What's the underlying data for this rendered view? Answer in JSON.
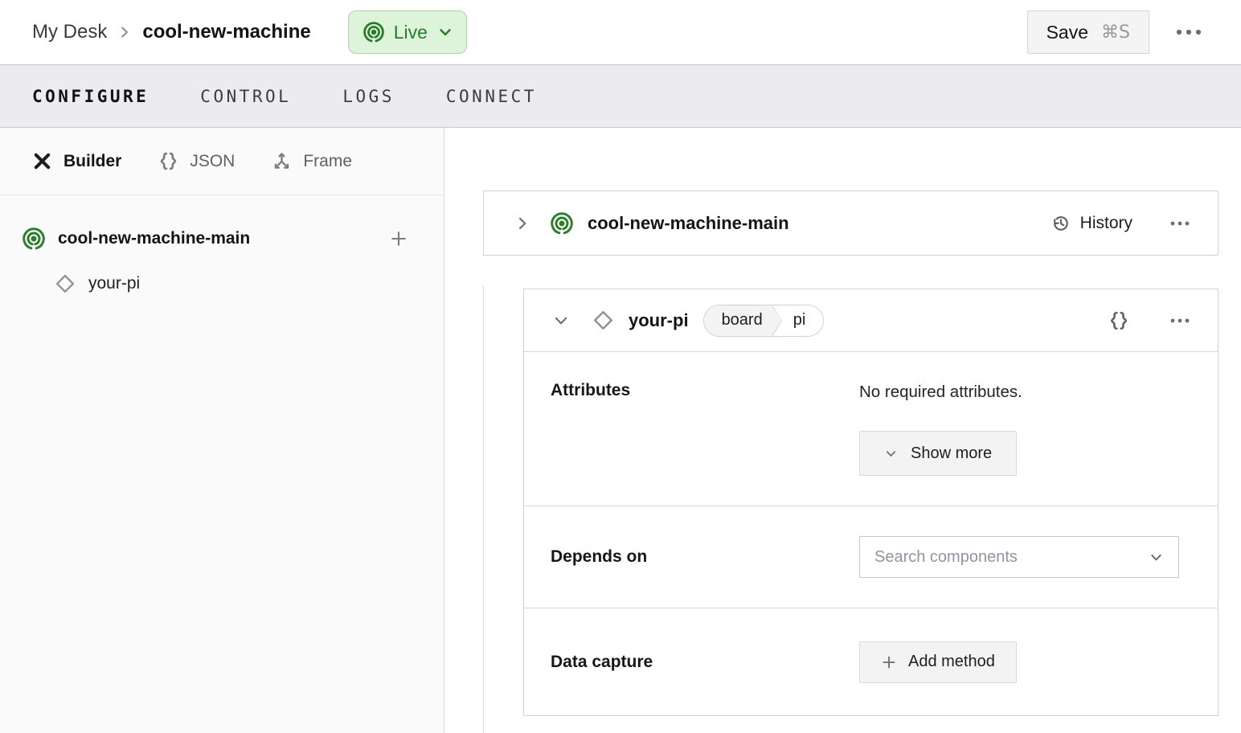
{
  "topbar": {
    "breadcrumb": {
      "parent": "My Desk",
      "current": "cool-new-machine"
    },
    "live_badge": {
      "label": "Live",
      "icon": "broadcast-icon"
    },
    "save_button": {
      "label": "Save",
      "shortcut": "⌘S"
    },
    "overflow_icon": "ellipsis-icon"
  },
  "tabs": [
    {
      "label": "CONFIGURE",
      "active": true
    },
    {
      "label": "CONTROL",
      "active": false
    },
    {
      "label": "LOGS",
      "active": false
    },
    {
      "label": "CONNECT",
      "active": false
    }
  ],
  "sidebar": {
    "modes": [
      {
        "label": "Builder",
        "icon": "crossed-tools-icon",
        "active": true
      },
      {
        "label": "JSON",
        "icon": "braces-icon",
        "active": false
      },
      {
        "label": "Frame",
        "icon": "frame-axes-icon",
        "active": false
      }
    ],
    "tree": {
      "machine": {
        "label": "cool-new-machine-main",
        "icon": "broadcast-icon",
        "add_icon": "plus-icon"
      },
      "component": {
        "label": "your-pi",
        "icon": "diamond-icon"
      }
    }
  },
  "main": {
    "machine_card": {
      "title": "cool-new-machine-main",
      "history_label": "History",
      "icon": "broadcast-icon"
    },
    "component_card": {
      "title": "your-pi",
      "type_tag": "board",
      "model_tag": "pi",
      "icon": "diamond-icon",
      "attributes": {
        "label": "Attributes",
        "empty_text": "No required attributes.",
        "show_more_label": "Show more"
      },
      "depends_on": {
        "label": "Depends on",
        "search_placeholder": "Search components"
      },
      "data_capture": {
        "label": "Data capture",
        "add_method_label": "Add method"
      }
    }
  },
  "colors": {
    "live_text_green": "#2a7b2a",
    "live_bg_green": "#ddf3da",
    "live_border_green": "#a9d8a3",
    "machine_icon_green": "#2e7d2e",
    "tabbar_bg": "#ececef",
    "sidebar_bg": "#fafafa",
    "card_border": "#d2d2d5",
    "button_bg": "#f3f3f4"
  }
}
